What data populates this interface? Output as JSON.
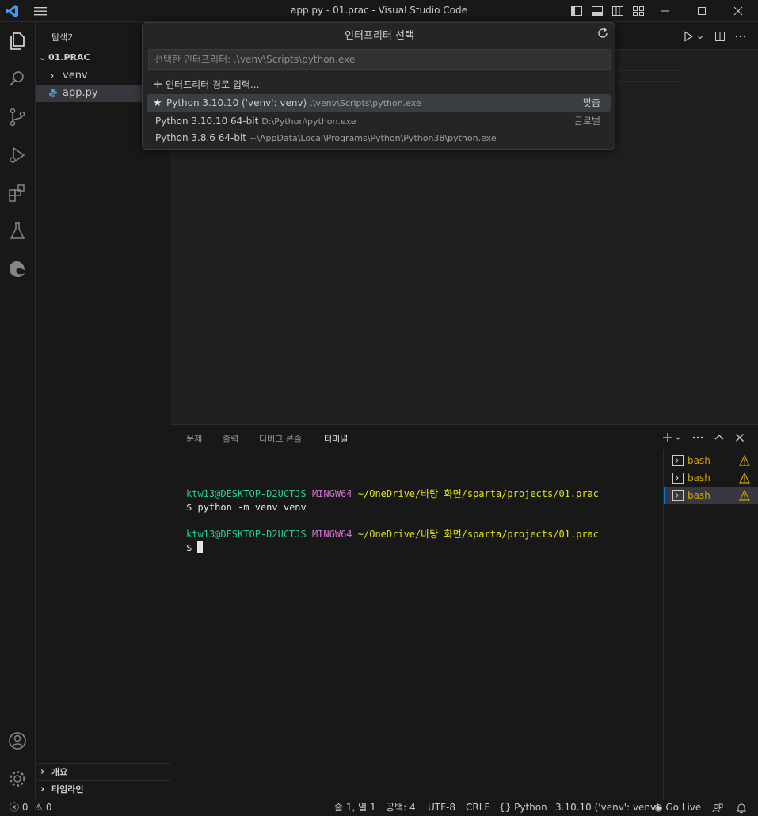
{
  "window": {
    "title": "app.py - 01.prac - Visual Studio Code"
  },
  "sidebar": {
    "title": "탐색기",
    "folder": "01.PRAC",
    "items": [
      {
        "label": "venv",
        "kind": "folder"
      },
      {
        "label": "app.py",
        "kind": "python-file"
      }
    ],
    "sections": [
      "개요",
      "타임라인"
    ]
  },
  "quickpick": {
    "title": "인터프리터 선택",
    "placeholder": "선택한 인터프리터: .\\venv\\Scripts\\python.exe",
    "enter_path": "인터프리터 경로 입력...",
    "items": [
      {
        "label": "Python 3.10.10 ('venv': venv)",
        "description": ".\\venv\\Scripts\\python.exe",
        "right": "맞춤"
      },
      {
        "label": "Python 3.10.10 64-bit",
        "description": "D:\\Python\\python.exe",
        "right": "글로벌"
      },
      {
        "label": "Python 3.8.6 64-bit",
        "description": "~\\AppData\\Local\\Programs\\Python\\Python38\\python.exe",
        "right": ""
      }
    ]
  },
  "panel": {
    "tabs": [
      "문제",
      "출력",
      "디버그 콘솔",
      "터미널"
    ],
    "active_tab": "터미널",
    "terminal": {
      "user_host": "ktw13@DESKTOP-D2UCTJS",
      "shell": "MINGW64",
      "path": "~/OneDrive/바탕 화면/sparta/projects/01.prac",
      "prompt": "$",
      "command": "python -m venv venv"
    },
    "terminals": [
      "bash",
      "bash",
      "bash"
    ]
  },
  "statusbar": {
    "errors": "0",
    "warnings": "0",
    "position": "줄 1, 열 1",
    "spaces": "공백: 4",
    "encoding": "UTF-8",
    "eol": "CRLF",
    "language": "Python",
    "interpreter": "3.10.10 ('venv': venv)",
    "golive": "Go Live"
  },
  "colors": {
    "accent": "#0078d4",
    "warning": "#cca700",
    "terminal_green": "#23d18b",
    "terminal_magenta": "#d670d6",
    "terminal_yellow": "#e5e510"
  }
}
